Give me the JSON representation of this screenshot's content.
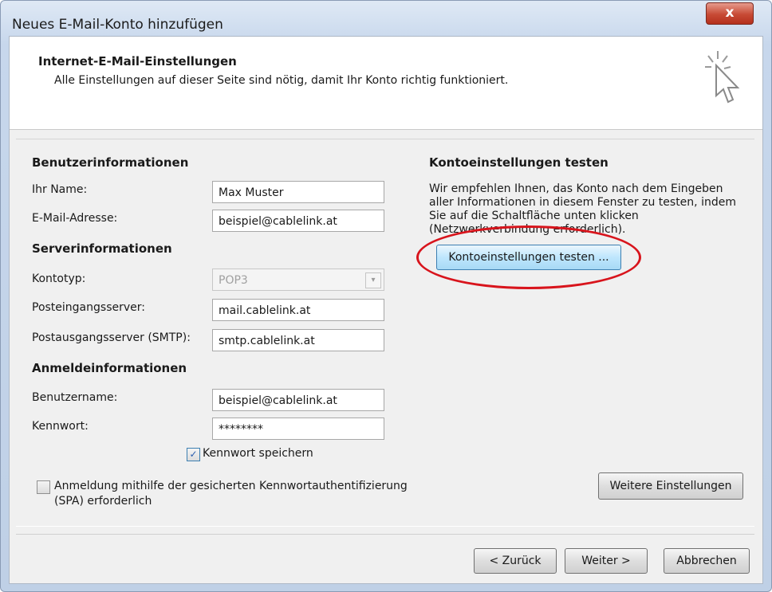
{
  "window": {
    "title": "Neues E-Mail-Konto hinzufügen",
    "close_label": "x"
  },
  "header": {
    "title": "Internet-E-Mail-Einstellungen",
    "subtitle": "Alle Einstellungen auf dieser Seite sind nötig, damit Ihr Konto richtig funktioniert.",
    "icon": "cursor-click-icon"
  },
  "user_info": {
    "heading": "Benutzerinformationen",
    "name_label": "Ihr Name:",
    "name_value": "Max Muster",
    "email_label": "E-Mail-Adresse:",
    "email_value": "beispiel@cablelink.at"
  },
  "server_info": {
    "heading": "Serverinformationen",
    "account_type_label": "Kontotyp:",
    "account_type_value": "POP3",
    "incoming_label": "Posteingangsserver:",
    "incoming_value": "mail.cablelink.at",
    "outgoing_label": "Postausgangsserver (SMTP):",
    "outgoing_value": "smtp.cablelink.at"
  },
  "login_info": {
    "heading": "Anmeldeinformationen",
    "username_label": "Benutzername:",
    "username_value": "beispiel@cablelink.at",
    "password_label": "Kennwort:",
    "password_value": "********",
    "remember_label": "Kennwort speichern",
    "remember_checked": true,
    "spa_label_1": "Anmeldung mithilfe der gesicherten Kennwortauthentifizierung",
    "spa_label_2": "(SPA) erforderlich",
    "spa_checked": false
  },
  "test_settings": {
    "heading": "Kontoeinstellungen testen",
    "line1": "Wir empfehlen Ihnen, das Konto nach dem Eingeben",
    "line2": "aller Informationen in diesem Fenster zu testen, indem",
    "line3": "Sie auf die Schaltfläche unten klicken",
    "line4": "(Netzwerkverbindung erforderlich).",
    "button_label": "Kontoeinstellungen testen ...",
    "highlight_color": "#d8141c"
  },
  "more_settings_label": "Weitere Einstellungen",
  "footer": {
    "back_label": "< Zurück",
    "next_label": "Weiter >",
    "cancel_label": "Abbrechen"
  }
}
